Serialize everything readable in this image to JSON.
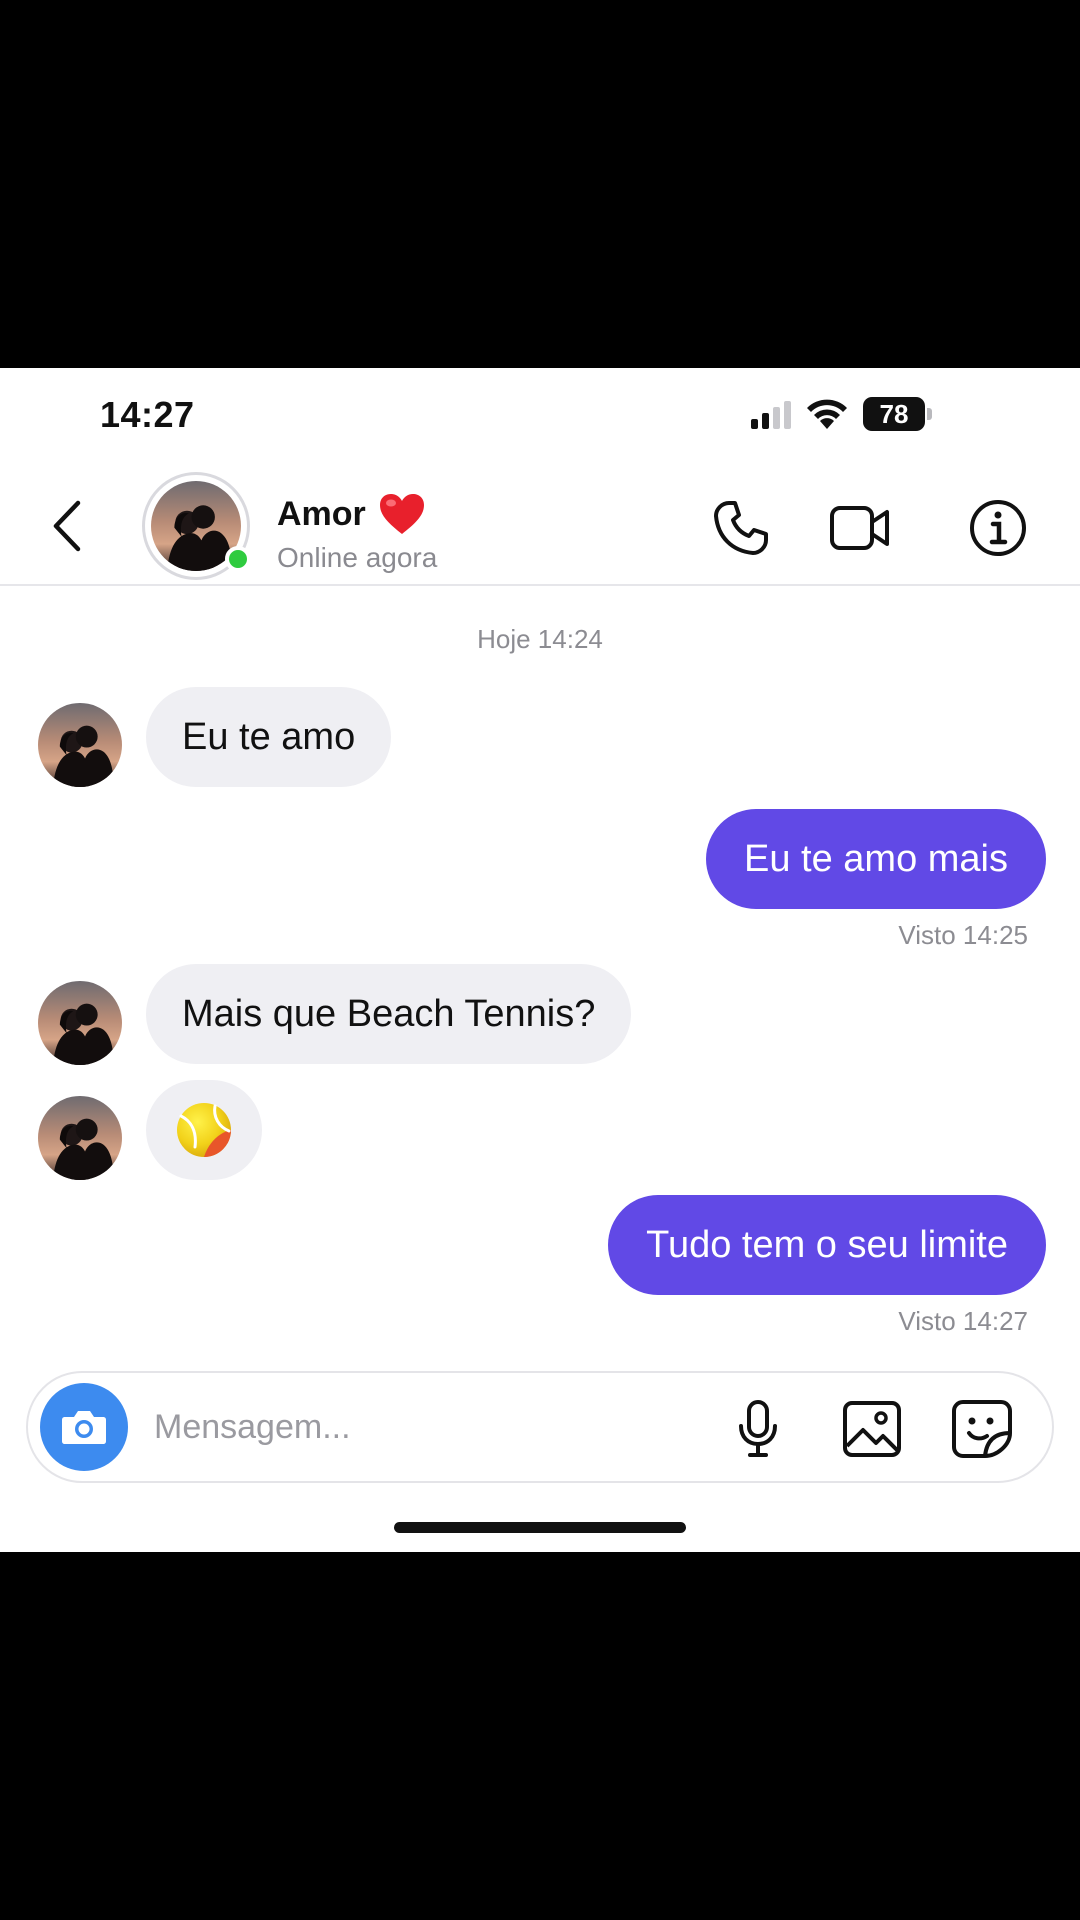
{
  "status_bar": {
    "time": "14:27",
    "battery": "78",
    "icons": [
      "cellular-signal-icon",
      "wifi-icon",
      "battery-icon"
    ]
  },
  "header": {
    "back_icon": "chevron-left-icon",
    "contact_name": "Amor",
    "name_emoji": "red-heart-icon",
    "status": "Online agora",
    "actions": [
      "phone-icon",
      "video-camera-icon",
      "info-icon"
    ]
  },
  "conversation": {
    "timestamp": "Hoje 14:24",
    "messages": [
      {
        "from": "contact",
        "text": "Eu te amo"
      },
      {
        "from": "me",
        "text": "Eu te amo mais",
        "seen": "Visto 14:25"
      },
      {
        "from": "contact",
        "text": "Mais que Beach Tennis?"
      },
      {
        "from": "contact",
        "emoji": "tennis-ball-icon"
      },
      {
        "from": "me",
        "text": "Tudo tem o seu limite",
        "seen": "Visto 14:27"
      }
    ]
  },
  "composer": {
    "placeholder": "Mensagem...",
    "value": "",
    "icons": [
      "camera-icon",
      "microphone-icon",
      "image-icon",
      "sticker-icon"
    ]
  },
  "colors": {
    "accent": "#6149e6",
    "camera_button": "#3d8bef",
    "online": "#2fcb3f",
    "incoming_bubble": "#efeff3"
  }
}
